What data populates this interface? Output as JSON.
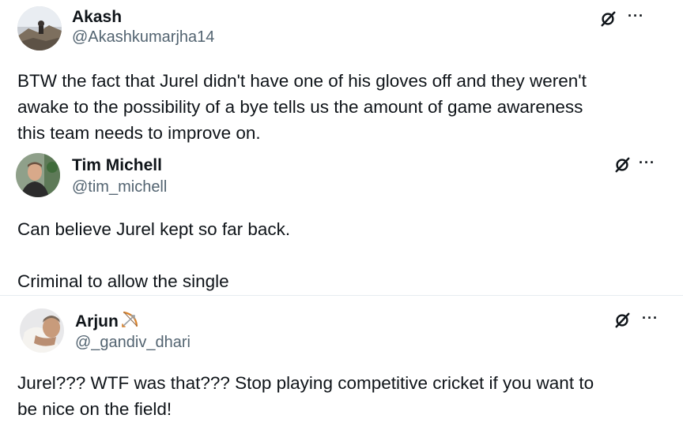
{
  "posts": [
    {
      "name": "Akash",
      "handle": "@Akashkumarjha14",
      "text": "BTW the fact that Jurel didn't have one of his gloves off and they weren't\nawake to the possibility of a bye tells us the amount of game awareness\nthis team needs to improve on."
    },
    {
      "name": "Tim Michell",
      "handle": "@tim_michell",
      "text": "Can believe Jurel kept so far back.\n\nCriminal to allow the single"
    },
    {
      "name": "Arjun",
      "handle": "@_gandiv_dhari",
      "text": "Jurel??? WTF was that??? Stop playing competitive cricket if you want to\nbe nice on the field!"
    }
  ],
  "icons": {
    "grok": "grok-icon",
    "more": "more-options-icon",
    "bow_emoji": "bow-and-arrow-emoji"
  },
  "more_glyph": "···",
  "colors": {
    "text": "#0f1419",
    "handle": "#536471",
    "background": "#ffffff"
  }
}
